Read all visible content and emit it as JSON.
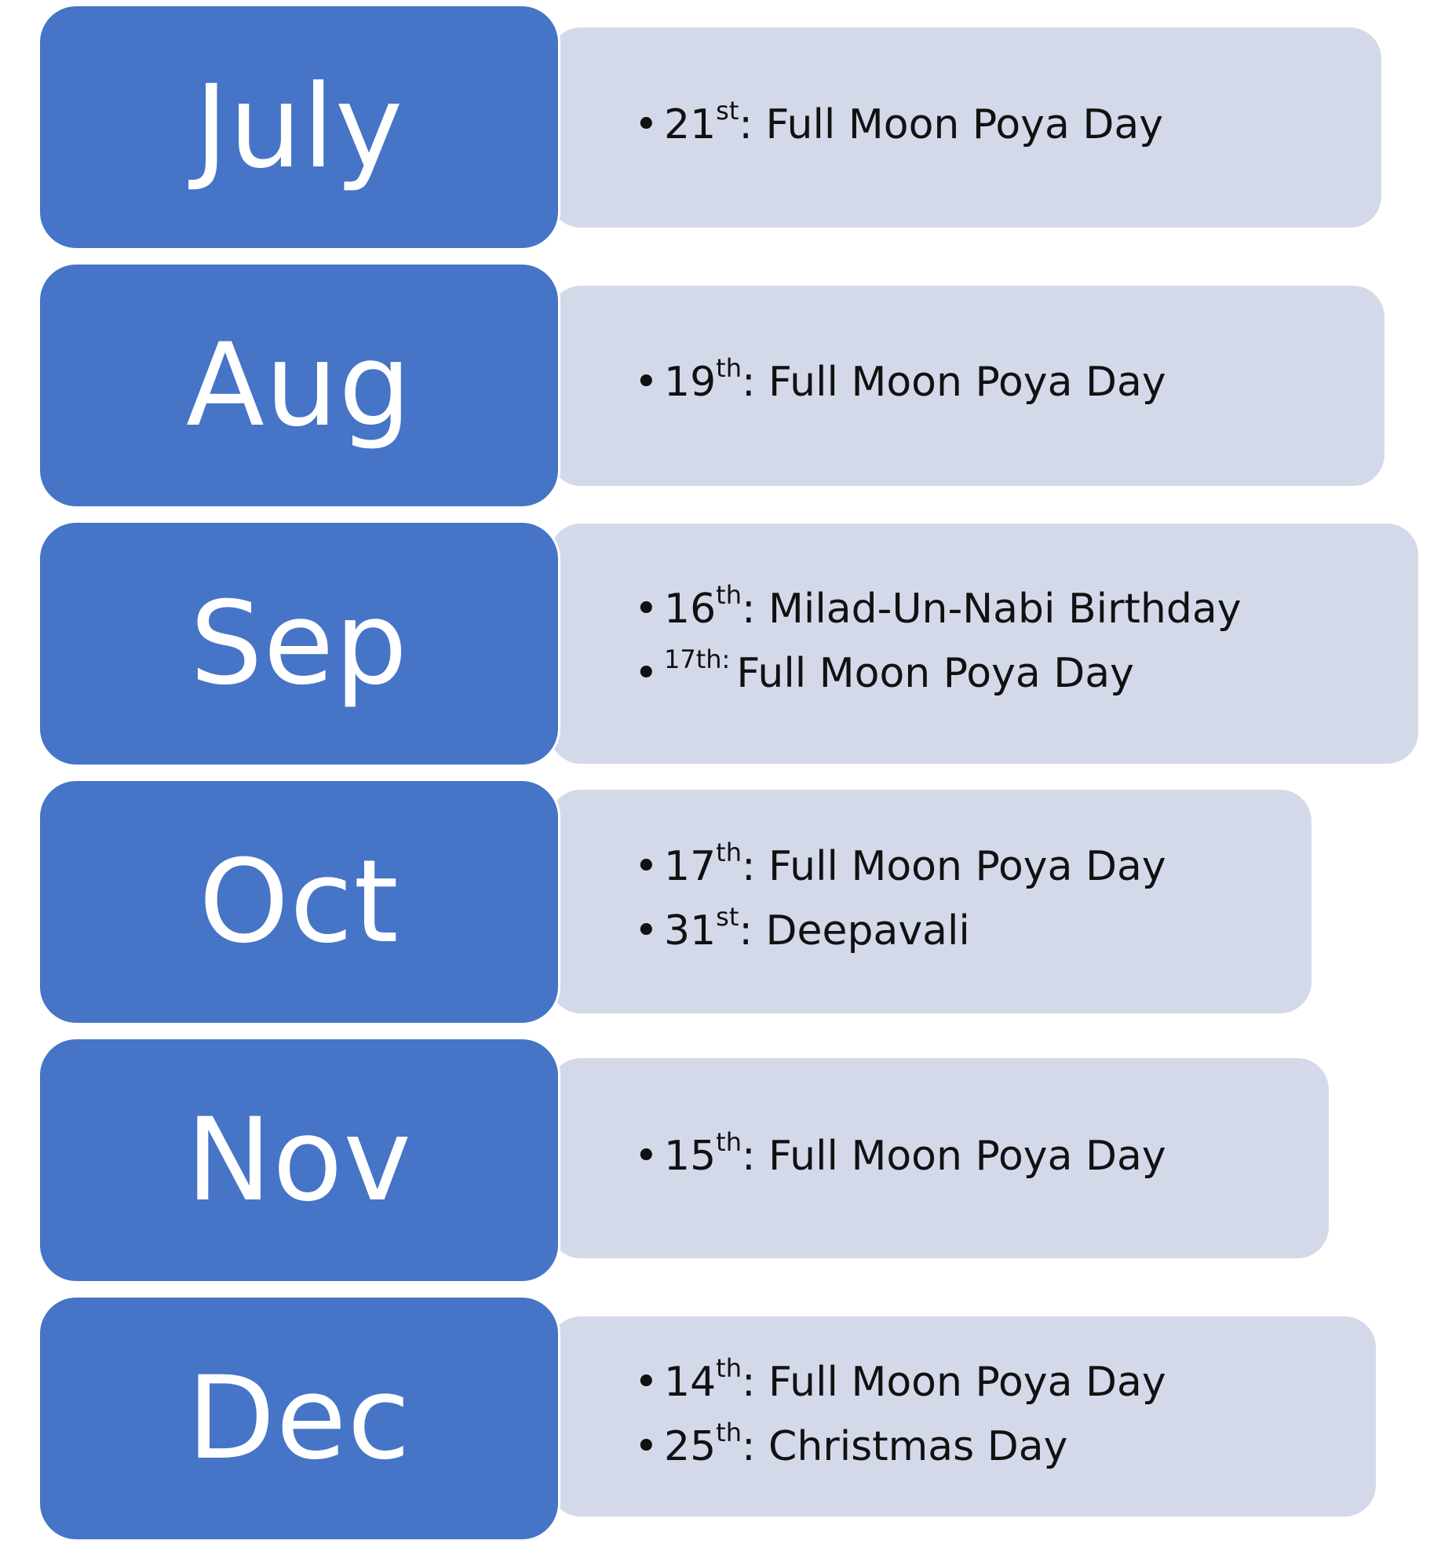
{
  "months": [
    {
      "label": "July",
      "events": [
        {
          "day": "21",
          "suffix": "st",
          "text": ": Full Moon Poya Day"
        }
      ]
    },
    {
      "label": "Aug",
      "events": [
        {
          "day": "19",
          "suffix": "th",
          "text": ": Full Moon Poya Day"
        }
      ]
    },
    {
      "label": "Sep",
      "events": [
        {
          "day": "16",
          "suffix": "th",
          "text": ": Milad-Un-Nabi Birthday"
        },
        {
          "prefix": "17th:",
          "text": "Full Moon Poya Day"
        }
      ]
    },
    {
      "label": "Oct",
      "events": [
        {
          "day": "17",
          "suffix": "th",
          "text": ": Full Moon Poya Day"
        },
        {
          "day": "31",
          "suffix": "st",
          "text": ": Deepavali"
        }
      ]
    },
    {
      "label": "Nov",
      "events": [
        {
          "day": "15",
          "suffix": "th",
          "text": ": Full Moon Poya Day"
        }
      ]
    },
    {
      "label": "Dec",
      "events": [
        {
          "day": "14",
          "suffix": "th",
          "text": ": Full Moon Poya Day"
        },
        {
          "day": "25",
          "suffix": "th",
          "text": ": Christmas Day"
        }
      ]
    }
  ],
  "colors": {
    "month_box": "#4674c6",
    "detail_box": "#d4d9ea",
    "month_text": "#ffffff",
    "event_text": "#111111"
  }
}
